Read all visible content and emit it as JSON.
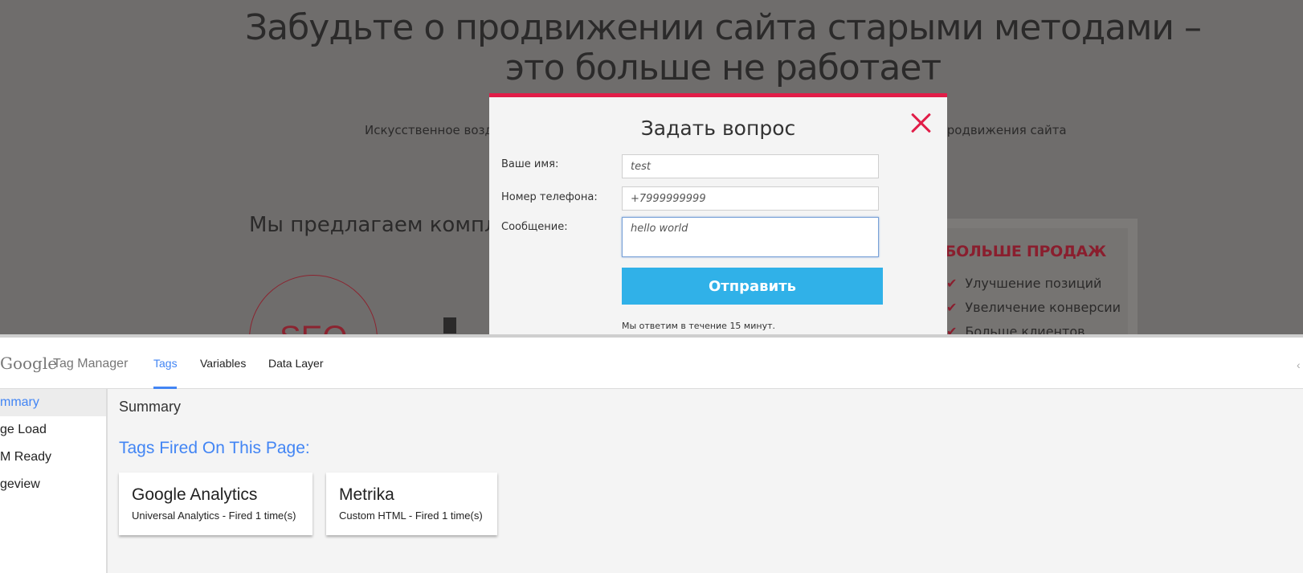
{
  "site": {
    "title_line1": "Забудьте о продвижении сайта старыми методами –",
    "title_line2": "это больше не работает",
    "subtitle_left": "Искусственное возде",
    "subtitle_right": "о продвижения сайта",
    "offer_heading": "Мы предлагаем комплек",
    "seo_badge": "SEO",
    "side_heading": "БОЛЬШЕ ПРОДАЖ",
    "benefits": [
      "Улучшение позиций",
      "Увеличение конверсии",
      "Больше клиентов"
    ]
  },
  "modal": {
    "title": "Задать вопрос",
    "name_label": "Ваше имя:",
    "name_value": "test",
    "phone_label": "Номер телефона:",
    "phone_value": "+7999999999",
    "message_label": "Сообщение:",
    "message_value": "hello world",
    "submit_label": "Отправить",
    "reply_note": "Мы ответим в течение 15 минут.",
    "accent_color": "#e11d48",
    "button_color": "#30b1e8"
  },
  "gtm": {
    "logo": "Google",
    "product": "Tag Manager",
    "tabs": [
      "Tags",
      "Variables",
      "Data Layer"
    ],
    "active_tab": "Tags",
    "sidebar": [
      "Summary",
      "Page Load",
      "DOM Ready",
      "Pageview"
    ],
    "sidebar_visible": [
      "mmary",
      "ge Load",
      "M Ready",
      "geview"
    ],
    "main_title": "Summary",
    "fired_heading": "Tags Fired On This Page:",
    "tags": [
      {
        "name": "Google Analytics",
        "meta": "Universal Analytics - Fired 1 time(s)"
      },
      {
        "name": "Metrika",
        "meta": "Custom HTML - Fired 1 time(s)"
      }
    ],
    "accent_color": "#4285f4"
  }
}
